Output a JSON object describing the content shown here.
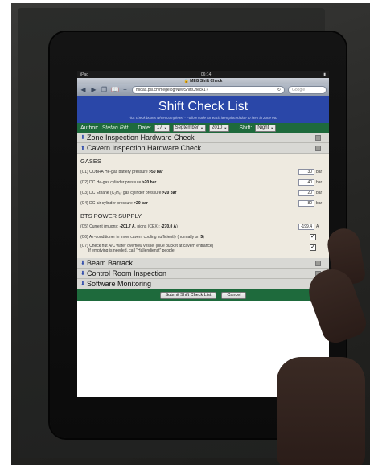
{
  "status": {
    "left": "iPad",
    "time": "06:14"
  },
  "browser": {
    "tab_title": "MEG Shift Check",
    "url": "midas.psi.ch/megelog/NewShiftCheck1?",
    "search_placeholder": "Google"
  },
  "page": {
    "title": "Shift Check List",
    "subtitle": "Tick check boxes when completed - Follow code for each item placed due to item in zone etc.",
    "author_label": "Author:",
    "author_name": "Stefan Ritt",
    "date_label": "Date:",
    "day": "17",
    "month": "September",
    "year": "2010",
    "shift_label": "Shift:",
    "shift": "Night"
  },
  "sections": {
    "zone": "Zone Inspection Hardware Check",
    "cavern": "Cavern Inspection Hardware Check",
    "beam": "Beam Barrack",
    "control": "Control Room Inspection",
    "software": "Software Monitoring"
  },
  "gases": {
    "heading": "GASES",
    "c1": {
      "label": "(C1) COBRA He-gas battery pressure",
      "limit": ">50 bar",
      "value": "30",
      "unit": "bar"
    },
    "c2": {
      "label": "(C2) DC He-gas cylinder pressure",
      "limit": ">20 bar",
      "value": "40",
      "unit": "bar"
    },
    "c3": {
      "label": "(C3) DC Ethane (C₂H₆) gas cylinder pressure",
      "limit": ">20 bar",
      "value": "20",
      "unit": "bar"
    },
    "c4": {
      "label": "(C4) DC air cylinder pressure",
      "limit": ">20 bar",
      "value": "80",
      "unit": "bar"
    }
  },
  "bts": {
    "heading": "BTS POWER SUPPLY",
    "c5": {
      "label": "(C5) Current (muons:",
      "muons": "-201.7 A",
      "mid": ", pions (CEX):",
      "pions": "-270.0 A",
      "end": ")",
      "value": "-199.4",
      "unit": "A"
    },
    "c6": {
      "label": "(C6) Air-conditioner in inner cavern cooling sufficiently (normally on",
      "num": "5",
      "end": ")",
      "mark": "✓"
    },
    "c7": {
      "line1": "(C7) Check hut A/C water overflow vessel (blue bucket at cavern entrance)",
      "line2": "If emptying is needed, call \"Hallendienst\" people",
      "mark": "✓"
    }
  },
  "footer": {
    "submit": "Submit Shift Check List",
    "cancel": "Cancel"
  },
  "colors": {
    "title_band": "#2a47a8",
    "green_bar": "#1e6a3c",
    "section_bg": "#d8d8d4"
  }
}
